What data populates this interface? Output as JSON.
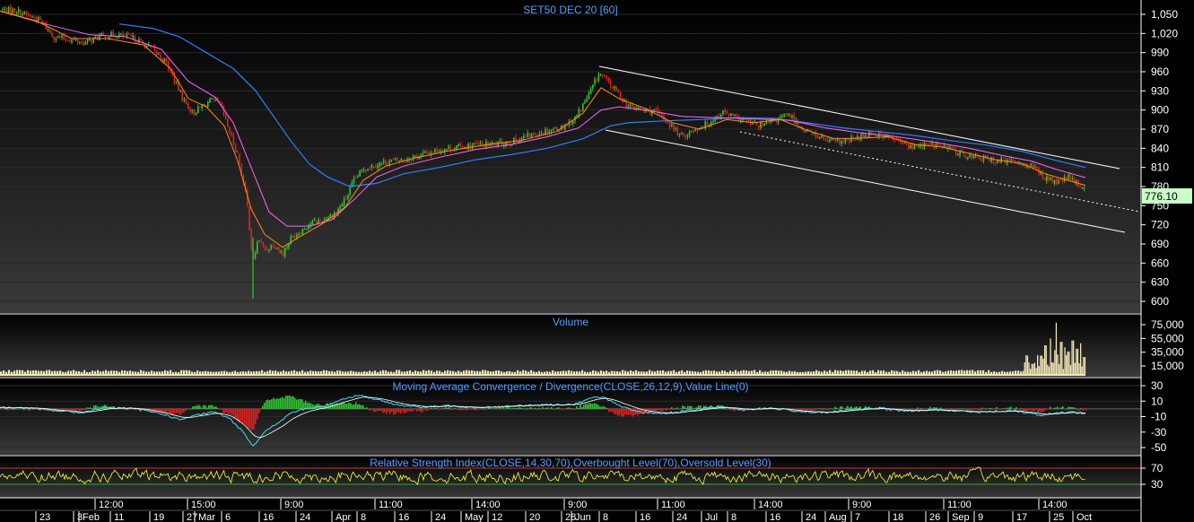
{
  "chart_data": [
    {
      "type": "candlestick",
      "title": "SET50 DEC 20   [60]",
      "yticks": [
        1050,
        1020,
        990,
        960,
        930,
        900,
        870,
        840,
        810,
        780,
        750,
        720,
        690,
        660,
        630,
        600
      ],
      "ytick_labels": [
        "1,050",
        "1,020",
        "990",
        "960",
        "930",
        "900",
        "870",
        "840",
        "810",
        "780",
        "750",
        "720",
        "690",
        "660",
        "630",
        "600"
      ],
      "ylim": [
        588,
        1062
      ],
      "last_value": "776.10",
      "close_path": [
        [
          0,
          1058
        ],
        [
          20,
          1055
        ],
        [
          45,
          1040
        ],
        [
          60,
          1015
        ],
        [
          80,
          1010
        ],
        [
          95,
          1005
        ],
        [
          110,
          1015
        ],
        [
          130,
          1018
        ],
        [
          150,
          1012
        ],
        [
          170,
          995
        ],
        [
          185,
          975
        ],
        [
          195,
          945
        ],
        [
          205,
          915
        ],
        [
          215,
          895
        ],
        [
          225,
          905
        ],
        [
          235,
          915
        ],
        [
          245,
          910
        ],
        [
          255,
          870
        ],
        [
          265,
          830
        ],
        [
          275,
          760
        ],
        [
          282,
          660
        ],
        [
          288,
          700
        ],
        [
          295,
          680
        ],
        [
          305,
          690
        ],
        [
          315,
          675
        ],
        [
          325,
          700
        ],
        [
          335,
          710
        ],
        [
          345,
          722
        ],
        [
          360,
          728
        ],
        [
          375,
          740
        ],
        [
          385,
          760
        ],
        [
          395,
          790
        ],
        [
          405,
          808
        ],
        [
          420,
          815
        ],
        [
          435,
          820
        ],
        [
          450,
          822
        ],
        [
          470,
          830
        ],
        [
          490,
          838
        ],
        [
          510,
          842
        ],
        [
          530,
          845
        ],
        [
          550,
          846
        ],
        [
          570,
          850
        ],
        [
          590,
          860
        ],
        [
          610,
          868
        ],
        [
          625,
          872
        ],
        [
          640,
          885
        ],
        [
          655,
          920
        ],
        [
          668,
          958
        ],
        [
          680,
          940
        ],
        [
          690,
          925
        ],
        [
          700,
          905
        ],
        [
          715,
          900
        ],
        [
          730,
          898
        ],
        [
          745,
          880
        ],
        [
          760,
          858
        ],
        [
          775,
          870
        ],
        [
          790,
          880
        ],
        [
          805,
          897
        ],
        [
          820,
          888
        ],
        [
          835,
          880
        ],
        [
          850,
          875
        ],
        [
          865,
          885
        ],
        [
          880,
          892
        ],
        [
          895,
          870
        ],
        [
          910,
          860
        ],
        [
          925,
          850
        ],
        [
          940,
          850
        ],
        [
          955,
          855
        ],
        [
          970,
          865
        ],
        [
          985,
          860
        ],
        [
          1000,
          852
        ],
        [
          1015,
          842
        ],
        [
          1030,
          845
        ],
        [
          1045,
          845
        ],
        [
          1060,
          838
        ],
        [
          1075,
          830
        ],
        [
          1090,
          825
        ],
        [
          1105,
          822
        ],
        [
          1120,
          820
        ],
        [
          1135,
          818
        ],
        [
          1150,
          812
        ],
        [
          1160,
          800
        ],
        [
          1170,
          790
        ],
        [
          1180,
          786
        ],
        [
          1190,
          795
        ],
        [
          1200,
          785
        ],
        [
          1210,
          776
        ]
      ],
      "ma_short": [
        [
          0,
          1055
        ],
        [
          40,
          1040
        ],
        [
          80,
          1012
        ],
        [
          120,
          1012
        ],
        [
          160,
          1002
        ],
        [
          190,
          965
        ],
        [
          210,
          918
        ],
        [
          230,
          905
        ],
        [
          250,
          875
        ],
        [
          265,
          820
        ],
        [
          280,
          745
        ],
        [
          295,
          705
        ],
        [
          315,
          685
        ],
        [
          335,
          702
        ],
        [
          360,
          722
        ],
        [
          385,
          748
        ],
        [
          405,
          790
        ],
        [
          430,
          812
        ],
        [
          460,
          824
        ],
        [
          500,
          836
        ],
        [
          540,
          845
        ],
        [
          580,
          852
        ],
        [
          620,
          866
        ],
        [
          650,
          895
        ],
        [
          670,
          935
        ],
        [
          690,
          918
        ],
        [
          720,
          902
        ],
        [
          750,
          880
        ],
        [
          780,
          870
        ],
        [
          810,
          885
        ],
        [
          840,
          880
        ],
        [
          870,
          885
        ],
        [
          900,
          868
        ],
        [
          930,
          855
        ],
        [
          960,
          856
        ],
        [
          990,
          858
        ],
        [
          1020,
          846
        ],
        [
          1050,
          842
        ],
        [
          1080,
          832
        ],
        [
          1110,
          822
        ],
        [
          1140,
          816
        ],
        [
          1165,
          800
        ],
        [
          1190,
          790
        ],
        [
          1210,
          782
        ]
      ],
      "ma_mid": [
        [
          0,
          1055
        ],
        [
          50,
          1035
        ],
        [
          100,
          1018
        ],
        [
          140,
          1015
        ],
        [
          180,
          995
        ],
        [
          210,
          945
        ],
        [
          240,
          920
        ],
        [
          260,
          880
        ],
        [
          280,
          810
        ],
        [
          300,
          740
        ],
        [
          320,
          718
        ],
        [
          345,
          718
        ],
        [
          370,
          728
        ],
        [
          395,
          760
        ],
        [
          420,
          795
        ],
        [
          450,
          812
        ],
        [
          490,
          826
        ],
        [
          530,
          838
        ],
        [
          570,
          846
        ],
        [
          610,
          858
        ],
        [
          645,
          872
        ],
        [
          670,
          900
        ],
        [
          690,
          905
        ],
        [
          720,
          900
        ],
        [
          760,
          890
        ],
        [
          800,
          888
        ],
        [
          840,
          886
        ],
        [
          880,
          884
        ],
        [
          920,
          872
        ],
        [
          960,
          864
        ],
        [
          1000,
          858
        ],
        [
          1040,
          850
        ],
        [
          1080,
          840
        ],
        [
          1120,
          828
        ],
        [
          1150,
          820
        ],
        [
          1175,
          808
        ],
        [
          1195,
          800
        ],
        [
          1210,
          794
        ]
      ],
      "ma_long": [
        [
          133,
          1035
        ],
        [
          170,
          1028
        ],
        [
          200,
          1015
        ],
        [
          230,
          990
        ],
        [
          260,
          965
        ],
        [
          285,
          930
        ],
        [
          305,
          890
        ],
        [
          325,
          850
        ],
        [
          345,
          815
        ],
        [
          365,
          795
        ],
        [
          390,
          780
        ],
        [
          420,
          785
        ],
        [
          450,
          800
        ],
        [
          490,
          810
        ],
        [
          530,
          822
        ],
        [
          570,
          830
        ],
        [
          610,
          840
        ],
        [
          650,
          855
        ],
        [
          680,
          875
        ],
        [
          700,
          880
        ],
        [
          740,
          883
        ],
        [
          780,
          885
        ],
        [
          820,
          888
        ],
        [
          860,
          887
        ],
        [
          900,
          880
        ],
        [
          940,
          872
        ],
        [
          980,
          866
        ],
        [
          1020,
          860
        ],
        [
          1060,
          852
        ],
        [
          1100,
          845
        ],
        [
          1140,
          835
        ],
        [
          1180,
          820
        ],
        [
          1210,
          810
        ]
      ]
    },
    {
      "type": "bar",
      "title": "Volume",
      "yticks": [
        75000,
        55000,
        35000,
        15000
      ],
      "ytick_labels": [
        "75,000",
        "55,000",
        "35,000",
        "15,000"
      ],
      "ylim": [
        5000,
        80000
      ],
      "spikes": [
        [
          1140,
          8000
        ],
        [
          1150,
          18000
        ],
        [
          1160,
          30000
        ],
        [
          1165,
          45000
        ],
        [
          1170,
          55000
        ],
        [
          1175,
          38000
        ],
        [
          1177,
          78000
        ],
        [
          1182,
          50000
        ],
        [
          1186,
          42000
        ],
        [
          1190,
          36000
        ],
        [
          1195,
          52000
        ],
        [
          1200,
          40000
        ],
        [
          1204,
          48000
        ],
        [
          1208,
          28000
        ]
      ]
    },
    {
      "type": "line",
      "title": "Moving Average Convergence / Divergence(CLOSE,26,12,9),Value Line(0)",
      "yticks": [
        30,
        10,
        -10,
        -30,
        -50
      ],
      "ytick_labels": [
        "30",
        "10",
        "-10",
        "-30",
        "-50"
      ],
      "ylim": [
        -62,
        38
      ],
      "macd_path": [
        [
          0,
          2
        ],
        [
          30,
          1
        ],
        [
          60,
          -2
        ],
        [
          90,
          -5
        ],
        [
          120,
          2
        ],
        [
          150,
          0
        ],
        [
          180,
          -6
        ],
        [
          200,
          -14
        ],
        [
          220,
          -8
        ],
        [
          240,
          -4
        ],
        [
          255,
          -12
        ],
        [
          270,
          -28
        ],
        [
          282,
          -48
        ],
        [
          295,
          -30
        ],
        [
          310,
          -18
        ],
        [
          325,
          -5
        ],
        [
          340,
          0
        ],
        [
          360,
          3
        ],
        [
          380,
          12
        ],
        [
          400,
          18
        ],
        [
          420,
          12
        ],
        [
          440,
          6
        ],
        [
          470,
          2
        ],
        [
          500,
          4
        ],
        [
          530,
          2
        ],
        [
          560,
          3
        ],
        [
          600,
          5
        ],
        [
          640,
          6
        ],
        [
          660,
          14
        ],
        [
          672,
          16
        ],
        [
          690,
          4
        ],
        [
          710,
          -4
        ],
        [
          740,
          -6
        ],
        [
          770,
          -2
        ],
        [
          800,
          3
        ],
        [
          830,
          -1
        ],
        [
          860,
          1
        ],
        [
          890,
          -3
        ],
        [
          920,
          -5
        ],
        [
          950,
          -1
        ],
        [
          980,
          1
        ],
        [
          1010,
          -3
        ],
        [
          1040,
          -1
        ],
        [
          1070,
          -3
        ],
        [
          1100,
          -4
        ],
        [
          1130,
          -2
        ],
        [
          1160,
          -8
        ],
        [
          1180,
          -5
        ],
        [
          1195,
          -4
        ],
        [
          1210,
          -6
        ]
      ]
    },
    {
      "type": "line",
      "title": "Relative Strength Index(CLOSE,14,30,70),Overbought Level(70),Oversold Level(30)",
      "yticks": [
        70,
        30
      ],
      "ytick_labels": [
        "70",
        "30"
      ],
      "ylim": [
        5,
        90
      ],
      "overbought": 70,
      "oversold": 30
    }
  ],
  "x_axis": {
    "labels_lower": [
      {
        "x": 44,
        "t": "23"
      },
      {
        "x": 86,
        "t": "3"
      },
      {
        "x": 92,
        "t": "Feb"
      },
      {
        "x": 127,
        "t": "11"
      },
      {
        "x": 171,
        "t": "19"
      },
      {
        "x": 208,
        "t": "27"
      },
      {
        "x": 221,
        "t": "Mar"
      },
      {
        "x": 251,
        "t": "6"
      },
      {
        "x": 293,
        "t": "16"
      },
      {
        "x": 334,
        "t": "24"
      },
      {
        "x": 374,
        "t": "Apr"
      },
      {
        "x": 402,
        "t": "8"
      },
      {
        "x": 444,
        "t": "16"
      },
      {
        "x": 485,
        "t": "24"
      },
      {
        "x": 518,
        "t": "May"
      },
      {
        "x": 548,
        "t": "12"
      },
      {
        "x": 590,
        "t": "20"
      },
      {
        "x": 630,
        "t": "28"
      },
      {
        "x": 641,
        "t": "Jun"
      },
      {
        "x": 672,
        "t": "8"
      },
      {
        "x": 713,
        "t": "16"
      },
      {
        "x": 754,
        "t": "24"
      },
      {
        "x": 786,
        "t": "Jul"
      },
      {
        "x": 815,
        "t": "8"
      },
      {
        "x": 858,
        "t": "16"
      },
      {
        "x": 898,
        "t": "24"
      },
      {
        "x": 924,
        "t": "Aug"
      },
      {
        "x": 953,
        "t": "7"
      },
      {
        "x": 995,
        "t": "18"
      },
      {
        "x": 1036,
        "t": "26"
      },
      {
        "x": 1061,
        "t": "Sep"
      },
      {
        "x": 1090,
        "t": "9"
      },
      {
        "x": 1133,
        "t": "17"
      },
      {
        "x": 1174,
        "t": "25"
      },
      {
        "x": 1200,
        "t": "Oct"
      }
    ],
    "labels_upper": [
      {
        "x": 110,
        "t": "12:00"
      },
      {
        "x": 213,
        "t": "15:00"
      },
      {
        "x": 317,
        "t": "9:00"
      },
      {
        "x": 422,
        "t": "11:00"
      },
      {
        "x": 530,
        "t": "14:00"
      },
      {
        "x": 633,
        "t": "9:00"
      },
      {
        "x": 737,
        "t": "11:00"
      },
      {
        "x": 845,
        "t": "14:00"
      },
      {
        "x": 950,
        "t": "9:00"
      },
      {
        "x": 1056,
        "t": "11:00"
      },
      {
        "x": 1162,
        "t": "14:00"
      }
    ]
  }
}
